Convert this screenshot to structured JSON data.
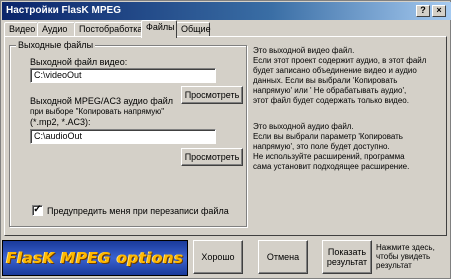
{
  "window": {
    "title": "Настройки FlasK MPEG",
    "help_label": "?",
    "close_label": "×"
  },
  "tabs": [
    {
      "label": "Видео"
    },
    {
      "label": "Аудио"
    },
    {
      "label": "Постобработка"
    },
    {
      "label": "Файлы"
    },
    {
      "label": "Общие"
    }
  ],
  "active_tab": "Файлы",
  "output_group": {
    "title": "Выходные файлы",
    "video_label": "Выходной файл видео:",
    "video_value": "C:\\videoOut",
    "audio_label_1": "Выходной MPEG/AC3 аудио файл",
    "audio_label_2": "при выборе \"Копировать напрямую\"",
    "audio_label_3": "(*.mp2, *.AC3):",
    "audio_value": "C:\\audioOut",
    "browse_label": "Просмотреть"
  },
  "video_description": [
    "Это выходной видео файл.",
    "Если этот проект содержит аудио, в этот файл",
    "будет записано объединение видео и аудио",
    "данных. Если вы выбрали 'Копировать",
    "напрямую' или ' Не обрабатывать аудио',",
    "этот файл будет содержать только видео."
  ],
  "audio_description": [
    "Это выходной аудио файл.",
    "Если вы выбрали параметр 'Копировать",
    "напрямую', это поле будет доступно.",
    "Не используйте расширений, программа",
    "сама установит подходящее расширение."
  ],
  "overwrite_warning": {
    "label": "Предупредить меня при перезаписи файла",
    "checked": true,
    "check_glyph": "✓"
  },
  "banner": {
    "text": "FlasK MPEG options"
  },
  "buttons": {
    "ok": "Хорошо",
    "cancel": "Отмена",
    "show_results_1": "Показать",
    "show_results_2": "результат"
  },
  "hint": [
    "Нажмите здесь,",
    "чтобы увидеть",
    "результат"
  ]
}
